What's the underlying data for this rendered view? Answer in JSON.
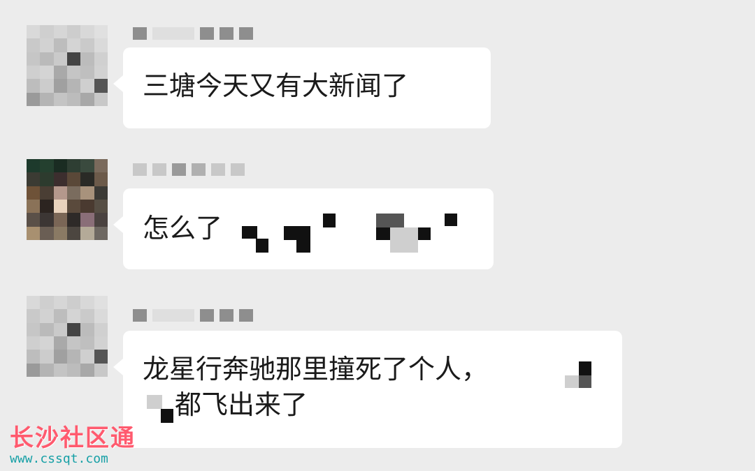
{
  "messages": [
    {
      "text": "三塘今天又有大新闻了"
    },
    {
      "text": "怎么了"
    },
    {
      "text_line1": "龙星行奔驰那里撞死了个人，",
      "text_line2": "都飞出来了"
    }
  ],
  "watermark": {
    "logo": "长沙社区通",
    "url": "www.cssqt.com"
  },
  "colors": {
    "background": "#ececec",
    "bubble": "#ffffff",
    "watermark_logo": "#ff5a6e",
    "watermark_url": "#17a0a6"
  }
}
